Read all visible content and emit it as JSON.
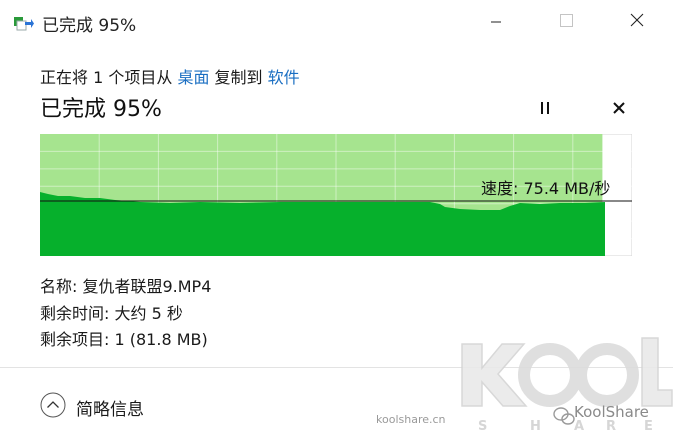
{
  "window": {
    "title": "已完成 95%",
    "app_icon": "file-copy-icon"
  },
  "header": {
    "prefix": "正在将 1 个项目从 ",
    "source": "桌面",
    "middle": " 复制到 ",
    "destination": "软件"
  },
  "status": {
    "title": "已完成 95%",
    "progress_percent": 95
  },
  "graph": {
    "speed_text": "速度: 75.4 MB/秒",
    "progress_fraction": 0.95,
    "colors": {
      "fill": "#06b02c",
      "background": "#a6e48f",
      "grid": "#ffffff"
    }
  },
  "details": {
    "name_label": "名称: ",
    "name_value": "复仇者联盟9.MP4",
    "time_label": "剩余时间: ",
    "time_value": "大约 5 秒",
    "items_label": "剩余项目: ",
    "items_value": "1 (81.8 MB)"
  },
  "footer": {
    "expand_label": "简略信息"
  },
  "watermark": {
    "logo_text": "KOOL SHARE",
    "site": "koolshare.cn",
    "brand": "KoolShare"
  }
}
